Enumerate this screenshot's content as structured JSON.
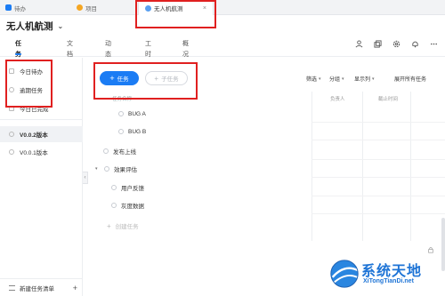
{
  "tabs": [
    {
      "label": "待办",
      "color": "#1b7cf4"
    },
    {
      "label": "项目",
      "color": "#f5a623"
    },
    {
      "label": "无人机航测",
      "color": "#5aa0f0",
      "close": "×"
    }
  ],
  "header": {
    "project_title": "无人机航测",
    "nav": [
      "任务清单",
      "文档",
      "动态",
      "工时",
      "概况"
    ]
  },
  "sidebar": {
    "items": [
      "今日待办",
      "逾期任务",
      "今日已完成"
    ],
    "versions": [
      "V0.0.2版本",
      "V0.0.1版本"
    ],
    "footer": "新建任务清单"
  },
  "toolbar": {
    "task_button": "任务",
    "subtask_button": "子任务",
    "filter": "筛选",
    "group": "分组",
    "display": "显示列",
    "expand": "展开所有任务"
  },
  "table": {
    "headers": {
      "name": "任务名称",
      "assignee": "负责人",
      "deadline": "截止时间"
    },
    "rows": [
      {
        "label": "BUG A"
      },
      {
        "label": "BUG B"
      },
      {
        "label": "发布上线"
      },
      {
        "label": "效果评估"
      },
      {
        "label": "用户反馈"
      },
      {
        "label": "灰度数据"
      }
    ],
    "add_task": "创建任务"
  },
  "watermark": {
    "title": "系统天地",
    "sub": "XiTongTianDi.net"
  }
}
